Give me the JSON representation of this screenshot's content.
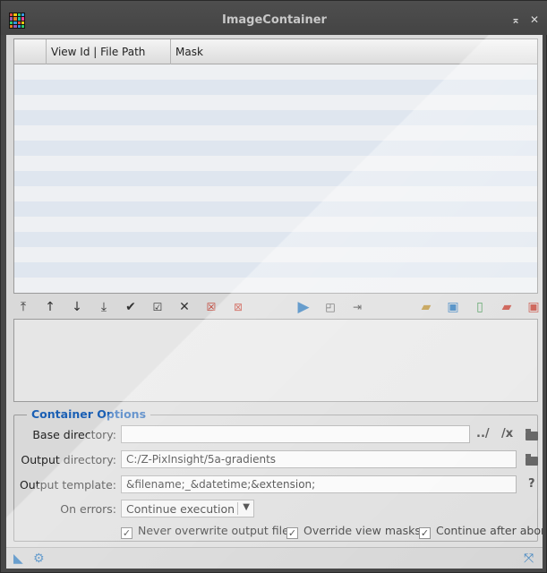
{
  "window": {
    "title": "ImageContainer",
    "controls": {
      "shade": "⌅",
      "close": "✕"
    }
  },
  "table": {
    "columns": [
      "",
      "View Id | File Path",
      "Mask"
    ],
    "row_count": 15
  },
  "toolbar": {
    "left_tools": [
      "move-to-top-icon",
      "move-up-icon",
      "move-down-icon",
      "move-to-bottom-icon",
      "enable-icon",
      "toggle-icon",
      "disable-icon",
      "remove-icon",
      "clear-icon"
    ],
    "center_tools": [
      "execute-icon",
      "select-view-icon",
      "add-view-icon"
    ],
    "right_tools": [
      "add-folder-icon",
      "add-window-icon",
      "add-file-icon",
      "remove-folder-icon",
      "remove-window-icon"
    ]
  },
  "options": {
    "legend": "Container Options",
    "base_directory": {
      "label": "Base directory:",
      "value": "",
      "up_label": "../",
      "clear_label": "/x"
    },
    "output_directory": {
      "label": "Output directory:",
      "value": "C:/Z-PixInsight/5a-gradients"
    },
    "output_template": {
      "label": "Output template:",
      "value": "&filename;_&datetime;&extension;",
      "help_label": "?"
    },
    "on_errors": {
      "label": "On errors:",
      "value": "Continue execution"
    },
    "checks": [
      {
        "label": "Never overwrite output files",
        "checked": true
      },
      {
        "label": "Override view masks",
        "checked": true
      },
      {
        "label": "Continue after abort",
        "checked": true
      }
    ]
  },
  "colors": {
    "accent": "#1a5fb4",
    "row_alt": "#dfe6ef",
    "danger": "#c0392b"
  }
}
